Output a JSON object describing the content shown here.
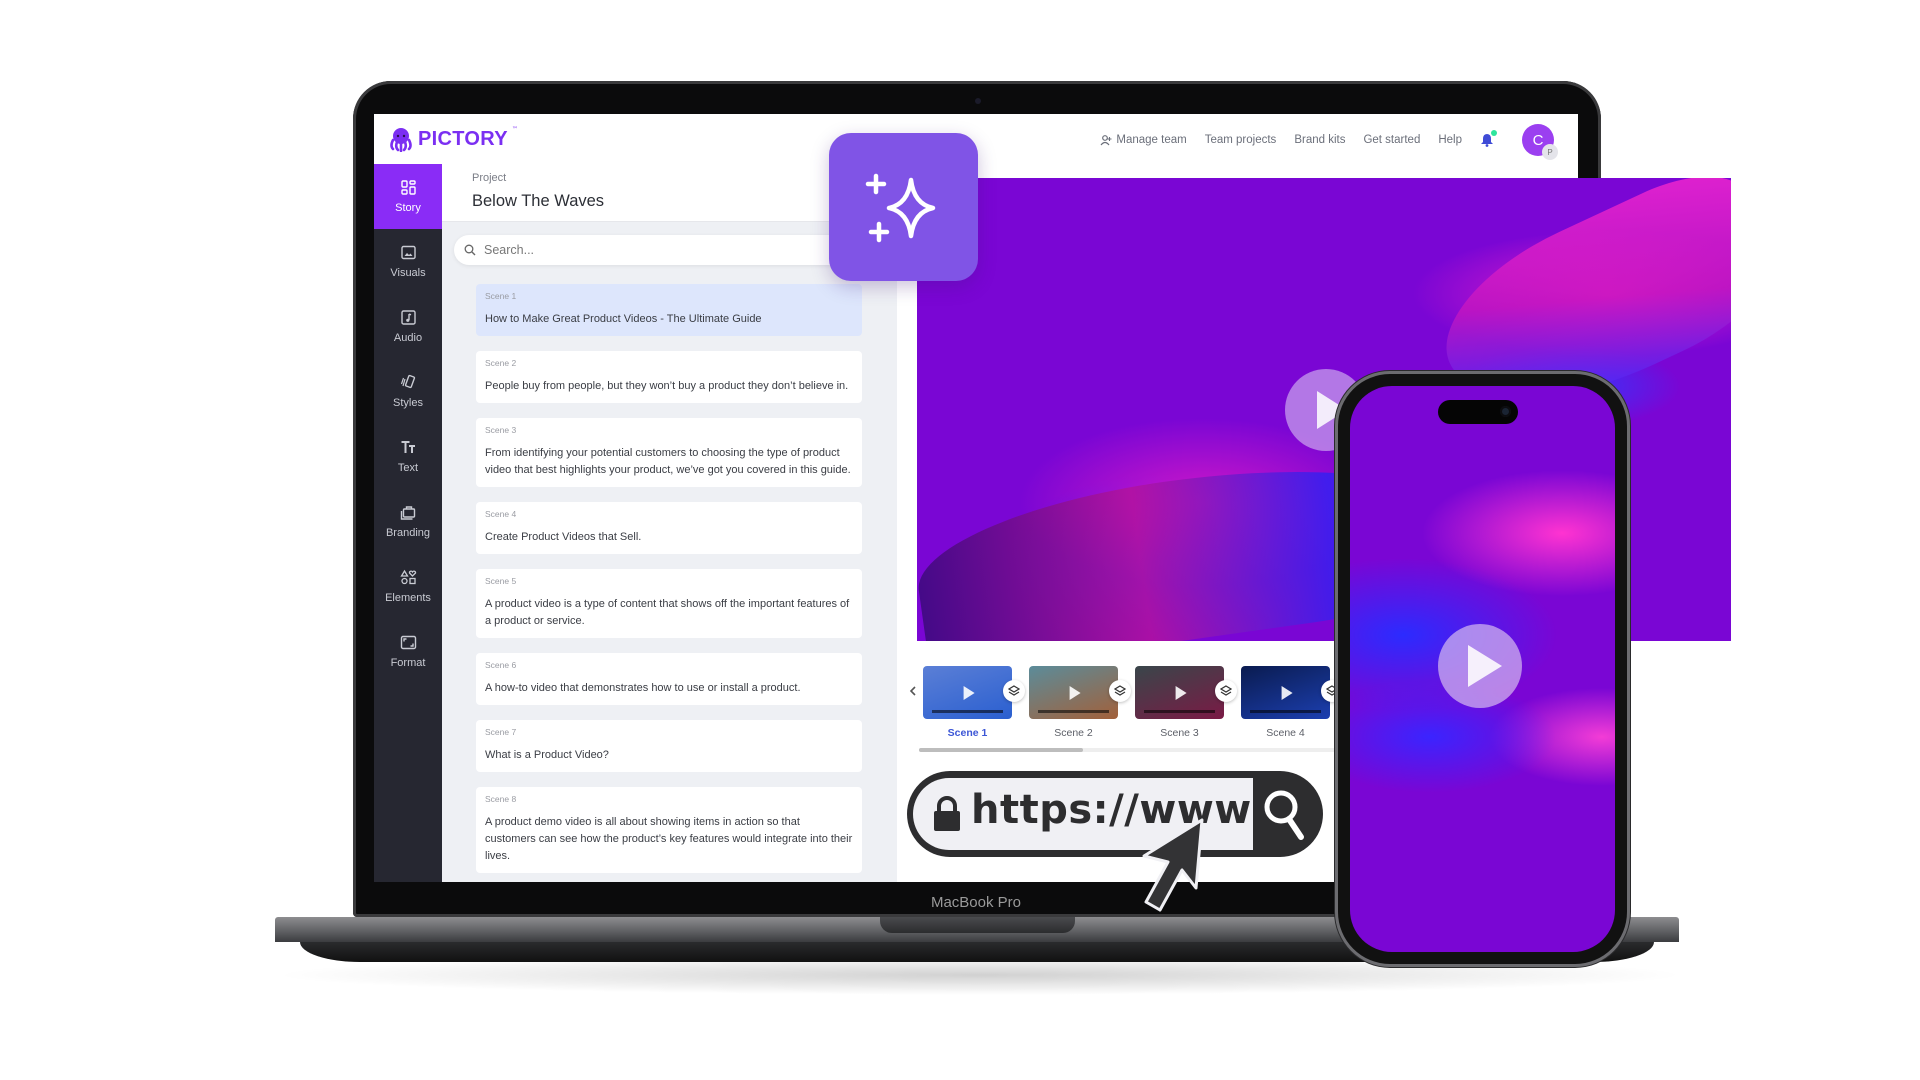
{
  "device": {
    "laptop_label": "MacBook Pro"
  },
  "app": {
    "brand": "PICTORY",
    "brand_tm": "™",
    "brand_color": "#7b2ff2",
    "accent_color": "#8a2cf6",
    "nav": {
      "manage_team": "Manage team",
      "team_projects": "Team projects",
      "brand_kits": "Brand kits",
      "get_started": "Get started",
      "help": "Help",
      "notification_icon": "bell-icon",
      "avatar_initial": "C",
      "avatar_badge": "P"
    },
    "sidebar": {
      "items": [
        {
          "label": "Story",
          "icon": "grid-icon",
          "active": true
        },
        {
          "label": "Visuals",
          "icon": "image-icon"
        },
        {
          "label": "Audio",
          "icon": "music-icon"
        },
        {
          "label": "Styles",
          "icon": "styles-icon"
        },
        {
          "label": "Text",
          "icon": "text-icon"
        },
        {
          "label": "Branding",
          "icon": "briefcase-icon"
        },
        {
          "label": "Elements",
          "icon": "shapes-icon"
        },
        {
          "label": "Format",
          "icon": "aspect-ratio-icon"
        }
      ]
    },
    "project": {
      "label": "Project",
      "title": "Below The Waves"
    },
    "search": {
      "placeholder": "Search...",
      "value": ""
    },
    "scenes": [
      {
        "num": "Scene 1",
        "text": "How to Make Great Product Videos - The Ultimate Guide",
        "active": true
      },
      {
        "num": "Scene 2",
        "text": "People buy from people, but they won’t buy a product they don’t believe in."
      },
      {
        "num": "Scene 3",
        "text": "From identifying your potential customers to choosing the type of product video that best highlights your product, we’ve got you covered in this guide."
      },
      {
        "num": "Scene 4",
        "text": "Create Product Videos that Sell."
      },
      {
        "num": "Scene 5",
        "text": "A product video is a type of content that shows off the important features of a product or service."
      },
      {
        "num": "Scene 6",
        "text": "A how-to video that demonstrates how to use or install a product."
      },
      {
        "num": "Scene 7",
        "text": "What is a Product Video?"
      },
      {
        "num": "Scene 8",
        "text": "A product demo video is all about showing items in action so that customers can see how the product’s key features would integrate into their lives."
      }
    ],
    "timeline": {
      "prev_icon": "chevron-left-icon",
      "thumbnails": [
        {
          "label": "Scene 1",
          "active": true,
          "colors": [
            "#5b7fd6",
            "#2a5fd0"
          ]
        },
        {
          "label": "Scene 2",
          "colors": [
            "#5b8c9a",
            "#a2603a"
          ]
        },
        {
          "label": "Scene 3",
          "colors": [
            "#39464a",
            "#7a1a45"
          ]
        },
        {
          "label": "Scene 4",
          "colors": [
            "#0a1b4f",
            "#1c3fb0"
          ]
        }
      ],
      "scroll_position": 0.39
    }
  },
  "overlays": {
    "ai_tile_icon": "sparkle-icon",
    "url_text": "https://www",
    "url_lock_icon": "lock-icon",
    "url_search_icon": "magnifier-icon",
    "cursor_icon": "pointer-arrow-icon"
  }
}
